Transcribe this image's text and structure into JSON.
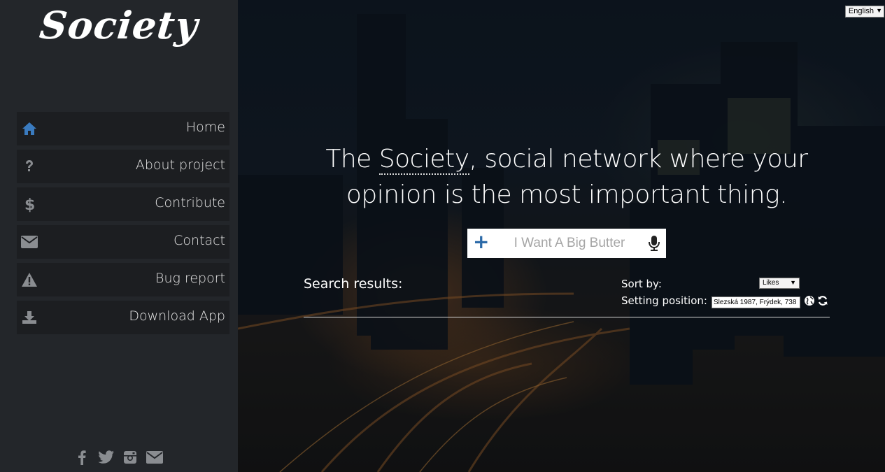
{
  "app": {
    "logo_text": "Society"
  },
  "sidebar": {
    "items": [
      {
        "label": "Home",
        "icon": "home-icon",
        "active": true
      },
      {
        "label": "About project",
        "icon": "question-icon"
      },
      {
        "label": "Contribute",
        "icon": "dollar-icon"
      },
      {
        "label": "Contact",
        "icon": "envelope-icon"
      },
      {
        "label": "Bug report",
        "icon": "warning-icon"
      },
      {
        "label": "Download App",
        "icon": "download-icon"
      }
    ],
    "social": [
      "facebook-icon",
      "twitter-icon",
      "instagram-icon",
      "envelope-icon"
    ]
  },
  "header": {
    "language": "English"
  },
  "hero": {
    "line1_pre": "The ",
    "line1_highlight": "Society",
    "line1_post": ", social network where your",
    "line2": "opinion is the most important thing."
  },
  "search": {
    "placeholder": "I Want A Big Butter",
    "value": ""
  },
  "results": {
    "label": "Search results:",
    "sort_label": "Sort by:",
    "sort_value": "Likes",
    "position_label": "Setting position:",
    "position_value": "Slezská 1987, Frýdek, 738"
  },
  "colors": {
    "sidebar_bg": "#23262a",
    "nav_item_bg": "#1c1e21",
    "accent": "#3a7bbf",
    "icon_gray": "#8a8d91",
    "text": "#e6e6e6"
  }
}
